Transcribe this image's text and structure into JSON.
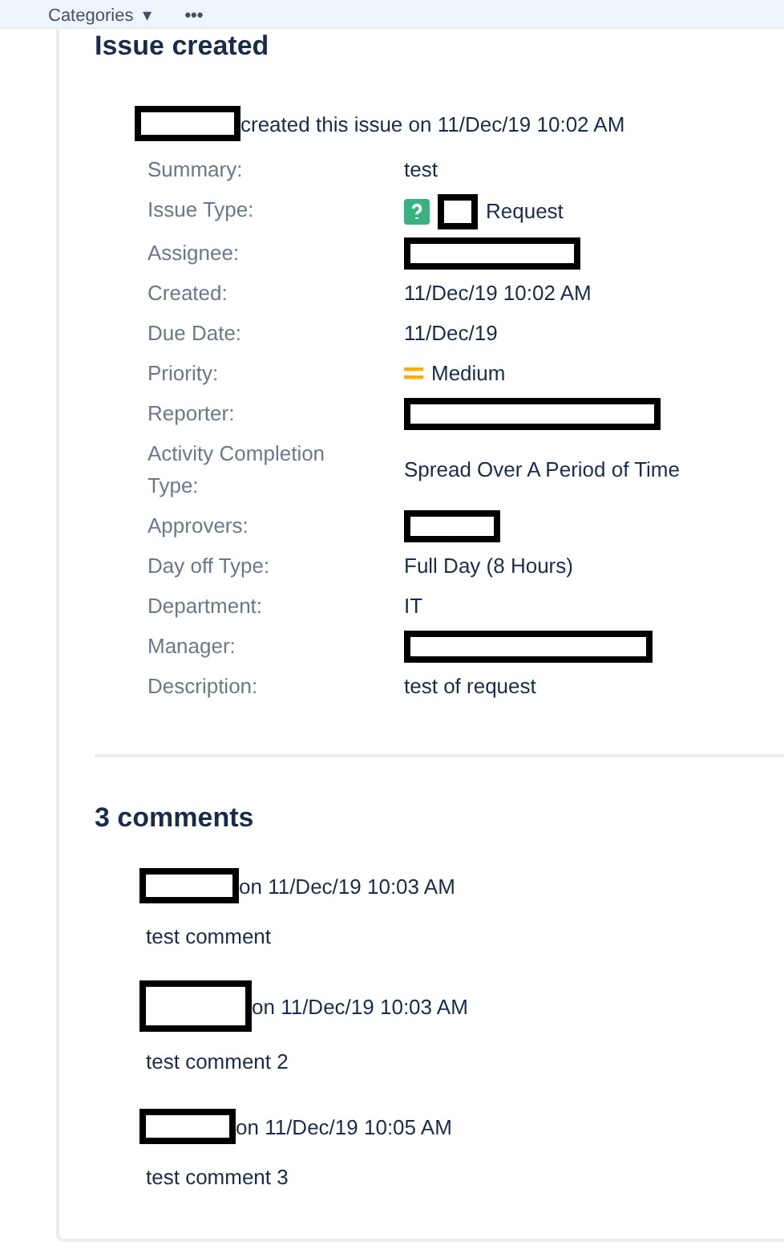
{
  "top_bar": {
    "menu_label": "Categories",
    "menu_caret": "▾",
    "more": "•••"
  },
  "issue": {
    "title": "Issue created",
    "author_redacted": true,
    "created_line": "created this issue on 11/Dec/19 10:02 AM",
    "fields": [
      {
        "label": "Summary:",
        "kind": "text",
        "value": "test"
      },
      {
        "label": "Issue Type:",
        "kind": "issue_type",
        "value": "Request"
      },
      {
        "label": "Assignee:",
        "kind": "redacted"
      },
      {
        "label": "Created:",
        "kind": "text",
        "value": "11/Dec/19 10:02 AM"
      },
      {
        "label": "Due Date:",
        "kind": "text",
        "value": "11/Dec/19"
      },
      {
        "label": "Priority:",
        "kind": "priority",
        "value": "Medium"
      },
      {
        "label": "Reporter:",
        "kind": "redacted"
      },
      {
        "label": "Activity Completion Type:",
        "kind": "text",
        "value": "Spread Over A Period of Time"
      },
      {
        "label": "Approvers:",
        "kind": "redacted"
      },
      {
        "label": "Day off Type:",
        "kind": "text",
        "value": "Full Day (8 Hours)"
      },
      {
        "label": "Department:",
        "kind": "text",
        "value": "IT"
      },
      {
        "label": "Manager:",
        "kind": "redacted"
      },
      {
        "label": "Description:",
        "kind": "text",
        "value": "test of request"
      }
    ]
  },
  "comments": {
    "title": "3 comments",
    "items": [
      {
        "author_redacted": true,
        "meta": "on 11/Dec/19 10:03 AM",
        "body": "test comment"
      },
      {
        "author_redacted": true,
        "meta": "on 11/Dec/19 10:03 AM",
        "body": "test comment 2"
      },
      {
        "author_redacted": true,
        "meta": "on 11/Dec/19 10:05 AM",
        "body": "test comment 3"
      }
    ]
  }
}
